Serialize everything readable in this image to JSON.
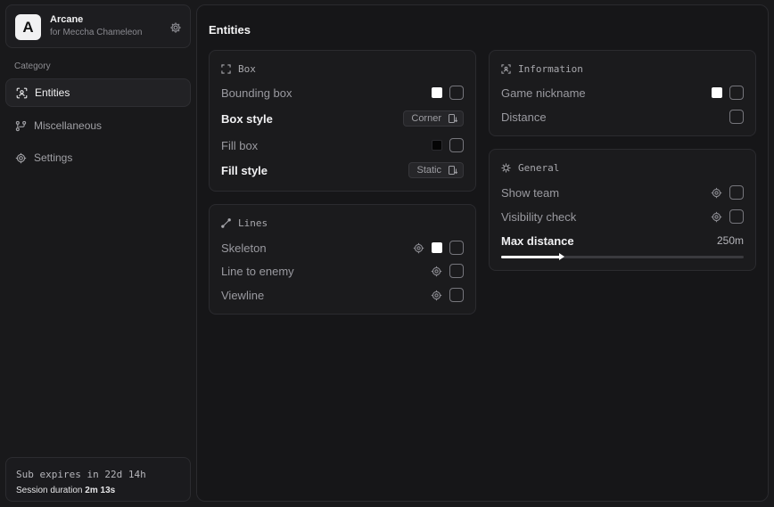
{
  "app": {
    "logo_letter": "A",
    "name": "Arcane",
    "subtitle": "for Meccha Chameleon"
  },
  "sidebar": {
    "category_label": "Category",
    "items": [
      {
        "label": "Entities",
        "icon": "entities-icon",
        "active": true
      },
      {
        "label": "Miscellaneous",
        "icon": "misc-icon",
        "active": false
      },
      {
        "label": "Settings",
        "icon": "gear-icon",
        "active": false
      }
    ]
  },
  "status": {
    "sub_expires": "Sub expires in 22d 14h",
    "session_label": "Session duration",
    "session_value": "2m 13s"
  },
  "main": {
    "title": "Entities",
    "panels": {
      "box": {
        "title": "Box",
        "rows": [
          {
            "label": "Bounding box",
            "swatch": "white",
            "checked": false
          },
          {
            "label": "Box style",
            "select": "Corner"
          },
          {
            "label": "Fill box",
            "swatch": "black",
            "checked": false
          },
          {
            "label": "Fill style",
            "select": "Static"
          }
        ]
      },
      "lines": {
        "title": "Lines",
        "rows": [
          {
            "label": "Skeleton",
            "gear": true,
            "swatch": "white",
            "checked": false
          },
          {
            "label": "Line to enemy",
            "gear": true,
            "checked": false
          },
          {
            "label": "Viewline",
            "gear": true,
            "checked": false
          }
        ]
      },
      "information": {
        "title": "Information",
        "rows": [
          {
            "label": "Game nickname",
            "swatch": "white",
            "checked": false
          },
          {
            "label": "Distance",
            "checked": false
          }
        ]
      },
      "general": {
        "title": "General",
        "rows": [
          {
            "label": "Show team",
            "gear": true,
            "checked": false
          },
          {
            "label": "Visibility check",
            "gear": true,
            "checked": false
          }
        ],
        "max_distance": {
          "label": "Max distance",
          "value": "250m",
          "fraction": 0.25
        }
      }
    }
  },
  "colors": {
    "background": "#19191b",
    "panel": "#1b1b1d",
    "accent": "#ffffff",
    "muted_text": "#9a9aa0"
  }
}
